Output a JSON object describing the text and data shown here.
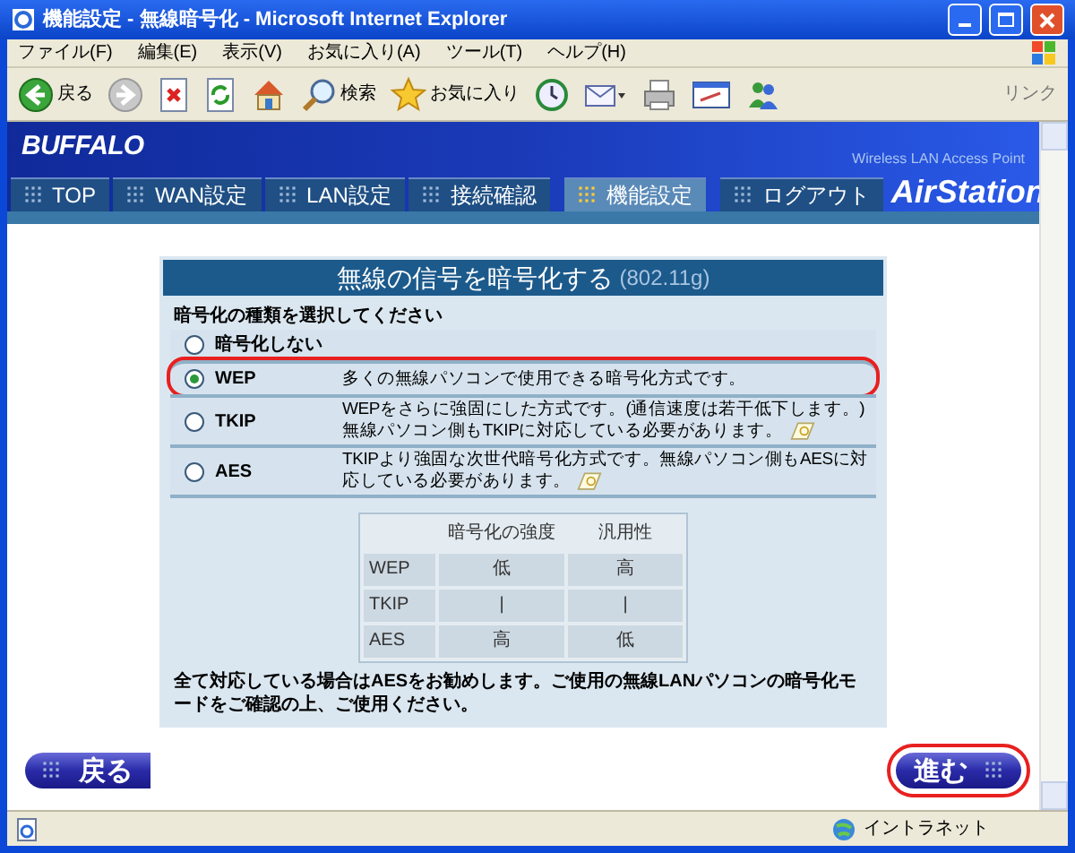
{
  "window": {
    "title": "機能設定 - 無線暗号化 - Microsoft Internet Explorer"
  },
  "menu": [
    "ファイル(F)",
    "編集(E)",
    "表示(V)",
    "お気に入り(A)",
    "ツール(T)",
    "ヘルプ(H)"
  ],
  "toolbar": [
    {
      "kind": "back",
      "label": "戻る"
    },
    {
      "kind": "forward"
    },
    {
      "kind": "stop"
    },
    {
      "kind": "refresh"
    },
    {
      "kind": "home"
    },
    {
      "kind": "search",
      "label": "検索"
    },
    {
      "kind": "favorites",
      "label": "お気に入り"
    },
    {
      "kind": "history"
    },
    {
      "kind": "mail"
    },
    {
      "kind": "print"
    },
    {
      "kind": "edit"
    },
    {
      "kind": "messenger"
    }
  ],
  "links_label": "リンク",
  "site": {
    "logo": "BUFFALO",
    "product_caption": "Wireless LAN Access Point",
    "product": "AirStation"
  },
  "tabs": [
    {
      "label": "TOP",
      "selected": false
    },
    {
      "label": "WAN設定",
      "selected": false
    },
    {
      "label": "LAN設定",
      "selected": false
    },
    {
      "label": "接続確認",
      "selected": false
    },
    {
      "label": "機能設定",
      "selected": true
    },
    {
      "label": "ログアウト",
      "selected": false
    }
  ],
  "panel": {
    "title": "無線の信号を暗号化する",
    "title_note": "(802.11g)",
    "prompt": "暗号化の種類を選択してください",
    "options": [
      {
        "label": "暗号化しない",
        "selected": false,
        "highlighted": false
      },
      {
        "label": "WEP",
        "description": "多くの無線パソコンで使用できる暗号化方式です。",
        "selected": true,
        "highlighted": true,
        "help": false
      },
      {
        "label": "TKIP",
        "description": "WEPをさらに強固にした方式です。(通信速度は若干低下します。)無線パソコン側もTKIPに対応している必要があります。",
        "selected": false,
        "highlighted": false,
        "help": true
      },
      {
        "label": "AES",
        "description": "TKIPより強固な次世代暗号化方式です。無線パソコン側もAESに対応している必要があります。",
        "selected": false,
        "highlighted": false,
        "help": true
      }
    ],
    "table": {
      "columns": [
        "暗号化の強度",
        "汎用性"
      ],
      "rows": [
        {
          "label": "WEP",
          "cells": [
            "低",
            "高"
          ]
        },
        {
          "label": "TKIP",
          "cells": [
            "|",
            "|"
          ]
        },
        {
          "label": "AES",
          "cells": [
            "高",
            "低"
          ]
        }
      ]
    },
    "note": "全て対応している場合はAESをお勧めします。ご使用の無線LANパソコンの暗号化モードをご確認の上、ご使用ください。"
  },
  "buttons": [
    {
      "kind": "back",
      "label": "戻る",
      "highlighted": false
    },
    {
      "kind": "next",
      "label": "進む",
      "highlighted": true
    }
  ],
  "status_bar": {
    "zone": "イントラネット"
  }
}
